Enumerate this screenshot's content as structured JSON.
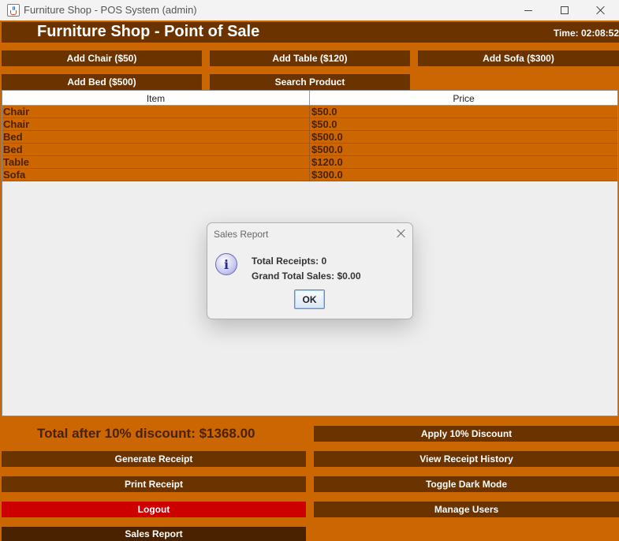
{
  "window": {
    "title": "Furniture Shop - POS System (admin)",
    "icon": "java-cup-icon"
  },
  "header": {
    "title": "Furniture Shop - Point of Sale",
    "time": "Time: 02:08:52"
  },
  "product_buttons": {
    "add_chair": "Add Chair ($50)",
    "add_table": "Add Table ($120)",
    "add_sofa": "Add Sofa ($300)",
    "add_bed": "Add Bed ($500)",
    "search": "Search Product"
  },
  "table": {
    "columns": [
      "Item",
      "Price"
    ],
    "rows": [
      {
        "item": "Chair",
        "price": "$50.0"
      },
      {
        "item": "Chair",
        "price": "$50.0"
      },
      {
        "item": "Bed",
        "price": "$500.0"
      },
      {
        "item": "Bed",
        "price": "$500.0"
      },
      {
        "item": "Table",
        "price": "$120.0"
      },
      {
        "item": "Sofa",
        "price": "$300.0"
      }
    ]
  },
  "footer": {
    "total": "Total after 10% discount: $1368.00",
    "apply_discount": "Apply 10% Discount",
    "generate_receipt": "Generate Receipt",
    "view_history": "View Receipt History",
    "print_receipt": "Print Receipt",
    "toggle_dark": "Toggle Dark Mode",
    "logout": "Logout",
    "manage_users": "Manage Users",
    "sales_report": "Sales Report"
  },
  "dialog": {
    "title": "Sales Report",
    "line1": "Total Receipts: 0",
    "line2": "Grand Total Sales: $0.00",
    "ok": "OK",
    "icon": "info-icon"
  },
  "colors": {
    "accent_orange": "#cc6600",
    "button_brown": "#6a3300",
    "logout_red": "#cc0000",
    "sales_report_dark": "#4a2200"
  }
}
